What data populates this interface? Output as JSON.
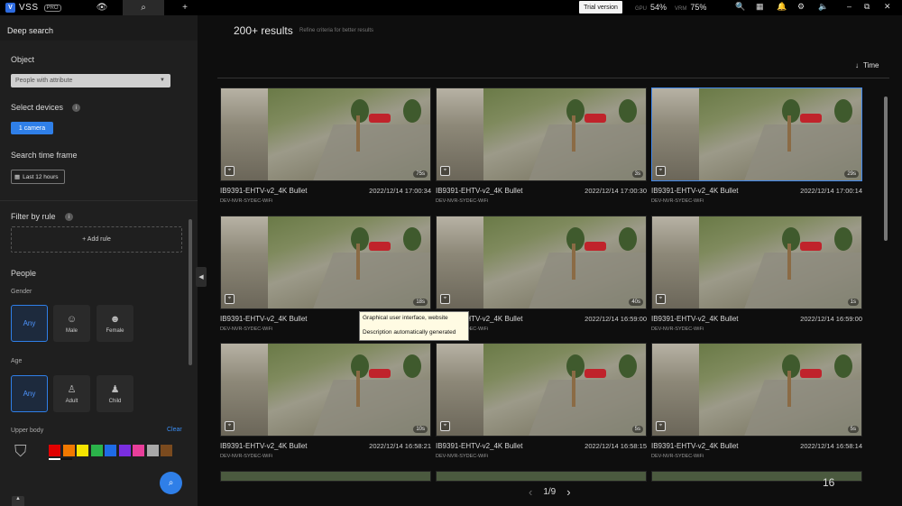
{
  "topbar": {
    "logo_text": "VSS",
    "logo_badge": "PRO",
    "trial_label": "Trial version",
    "gpu_label": "GPU",
    "gpu_value": "54%",
    "vram_label": "VRM",
    "vram_value": "75%"
  },
  "sidebar": {
    "title": "Deep search",
    "object_label": "Object",
    "object_select": "People with attribute",
    "devices_label": "Select devices",
    "devices_button": "1 camera",
    "timeframe_label": "Search time frame",
    "timeframe_button": "Last 12 hours",
    "filter_label": "Filter by rule",
    "add_rule": "+ Add rule",
    "people_label": "People",
    "gender_label": "Gender",
    "gender_options": [
      {
        "label": "Any",
        "icon": "any"
      },
      {
        "label": "Male",
        "icon": "male-icon"
      },
      {
        "label": "Female",
        "icon": "female-icon"
      }
    ],
    "age_label": "Age",
    "age_options": [
      {
        "label": "Any",
        "icon": "any"
      },
      {
        "label": "Adult",
        "icon": "adult-icon"
      },
      {
        "label": "Child",
        "icon": "child-icon"
      }
    ],
    "upper_body_label": "Upper body",
    "clear_label": "Clear",
    "colors": [
      "#e00000",
      "#f07800",
      "#f5e400",
      "#2bb34a",
      "#1e6be6",
      "#7a2ee0",
      "#e83e9a",
      "#a8a8a8",
      "#7a4a1e"
    ]
  },
  "main": {
    "results_count": "200+ results",
    "results_hint": "Refine criteria for better results",
    "sort_label": "Time",
    "tooltip_line1": "Graphical user interface, website",
    "tooltip_line2": "Description automatically generated",
    "pager_text": "1/9",
    "corner_number": "16",
    "results": [
      {
        "camera": "IB9391-EHTV-v2_4K Bullet",
        "time": "2022/12/14 17:00:34",
        "device": "DEV-NVR-SYDEC-WiFi",
        "duration": "75s"
      },
      {
        "camera": "IB9391-EHTV-v2_4K Bullet",
        "time": "2022/12/14 17:00:30",
        "device": "DEV-NVR-SYDEC-WiFi",
        "duration": "3s"
      },
      {
        "camera": "IB9391-EHTV-v2_4K Bullet",
        "time": "2022/12/14 17:00:14",
        "device": "DEV-NVR-SYDEC-WiFi",
        "duration": "29s"
      },
      {
        "camera": "IB9391-EHTV-v2_4K Bullet",
        "time": "",
        "device": "DEV-NVR-SYDEC-WiFi",
        "duration": "18s"
      },
      {
        "camera": "IB9391-EHTV-v2_4K Bullet",
        "time": "2022/12/14 16:59:00",
        "device": "DEV-NVR-SYDEC-WiFi",
        "duration": "40s"
      },
      {
        "camera": "IB9391-EHTV-v2_4K Bullet",
        "time": "2022/12/14 16:59:00",
        "device": "DEV-NVR-SYDEC-WiFi",
        "duration": "1s"
      },
      {
        "camera": "IB9391-EHTV-v2_4K Bullet",
        "time": "2022/12/14 16:58:21",
        "device": "DEV-NVR-SYDEC-WiFi",
        "duration": "10s"
      },
      {
        "camera": "IB9391-EHTV-v2_4K Bullet",
        "time": "2022/12/14 16:58:15",
        "device": "DEV-NVR-SYDEC-WiFi",
        "duration": "5s"
      },
      {
        "camera": "IB9391-EHTV-v2_4K Bullet",
        "time": "2022/12/14 16:58:14",
        "device": "DEV-NVR-SYDEC-WiFi",
        "duration": "5s"
      }
    ]
  }
}
